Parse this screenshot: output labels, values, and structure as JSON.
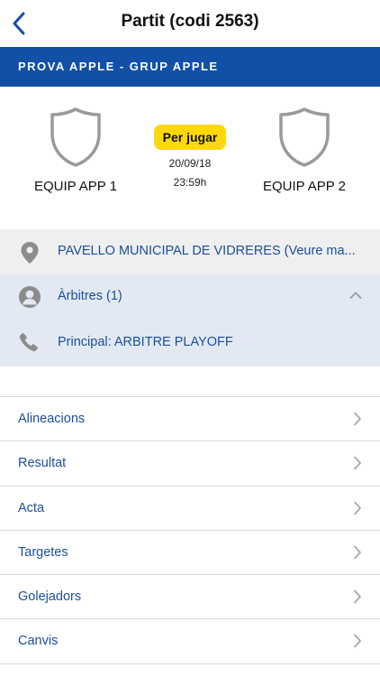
{
  "nav": {
    "title": "Partit (codi 2563)"
  },
  "group": {
    "label": "PROVA APPLE - GRUP APPLE"
  },
  "match": {
    "home_team": "EQUIP APP 1",
    "away_team": "EQUIP APP 2",
    "status": "Per jugar",
    "date": "20/09/18",
    "time": "23:59h"
  },
  "venue": {
    "text": "PAVELLO MUNICIPAL DE VIDRERES (Veure ma..."
  },
  "referees": {
    "header": "Àrbitres (1)",
    "items": [
      {
        "text": "Principal: ARBITRE PLAYOFF"
      }
    ]
  },
  "menu": {
    "items": [
      {
        "label": "Alineacions"
      },
      {
        "label": "Resultat"
      },
      {
        "label": "Acta"
      },
      {
        "label": "Targetes"
      },
      {
        "label": "Golejadors"
      },
      {
        "label": "Canvis"
      }
    ]
  },
  "colors": {
    "accent": "#1150a6",
    "link": "#1a4f9c",
    "badge": "#ffd80a",
    "referee_bg": "#e3e9f2",
    "venue_bg": "#efefef"
  },
  "icons": {
    "back": "chevron-left-icon",
    "team": "shield-icon",
    "venue": "location-pin-icon",
    "referee": "person-icon",
    "phone": "phone-icon",
    "collapse": "chevron-up-icon",
    "row": "chevron-right-icon"
  }
}
